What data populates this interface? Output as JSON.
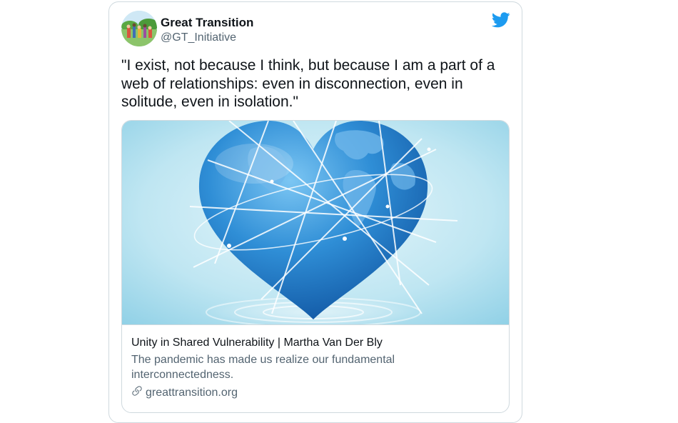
{
  "author": {
    "name": "Great Transition",
    "handle": "@GT_Initiative"
  },
  "tweet": {
    "text": "\"I exist, not because I think, but because I am a part of a web of relationships: even in disconnection, even in solitude, even in isolation.\""
  },
  "card": {
    "title": "Unity in Shared Vulnerability | Martha Van Der Bly",
    "description": "The pandemic has made us realize our fundamental interconnectedness.",
    "domain": "greattransition.org"
  },
  "icons": {
    "brand": "twitter-bird-icon",
    "link": "link-icon"
  },
  "colors": {
    "twitter_blue": "#1d9bf0",
    "text": "#0f1419",
    "muted": "#536471",
    "border": "#cfd9de"
  }
}
